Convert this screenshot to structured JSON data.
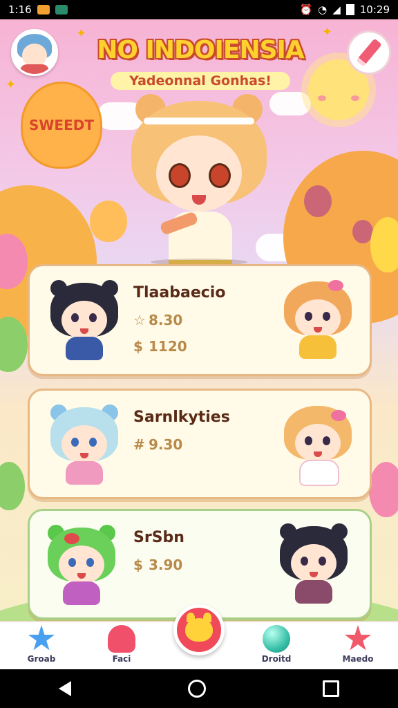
{
  "status_bar": {
    "time_left": "1:16",
    "time_right": "10:29"
  },
  "header": {
    "title": "NO INDOIENSIA",
    "subtitle": "Yadeonnal Gonhas!",
    "balloon_text": "SWEEDT"
  },
  "cards": [
    {
      "name": "Tlaabaecio",
      "stats": [
        {
          "symbol": "☆",
          "value": "8.30"
        },
        {
          "symbol": "$",
          "value": "1120"
        }
      ]
    },
    {
      "name": "Sarnlkyties",
      "stats": [
        {
          "symbol": "#",
          "value": "9.30"
        }
      ]
    },
    {
      "name": "SrSbn",
      "stats": [
        {
          "symbol": "$",
          "value": "3.90"
        }
      ]
    }
  ],
  "bottom_nav": [
    {
      "label": "Groab",
      "icon": "star-icon"
    },
    {
      "label": "Faci",
      "icon": "heart-icon"
    },
    {
      "label": "Droitd",
      "icon": "ball-icon"
    },
    {
      "label": "Maedo",
      "icon": "star-icon"
    }
  ],
  "colors": {
    "accent": "#f04a5a",
    "title": "#ffd12e",
    "card_border": "#e8b884"
  }
}
